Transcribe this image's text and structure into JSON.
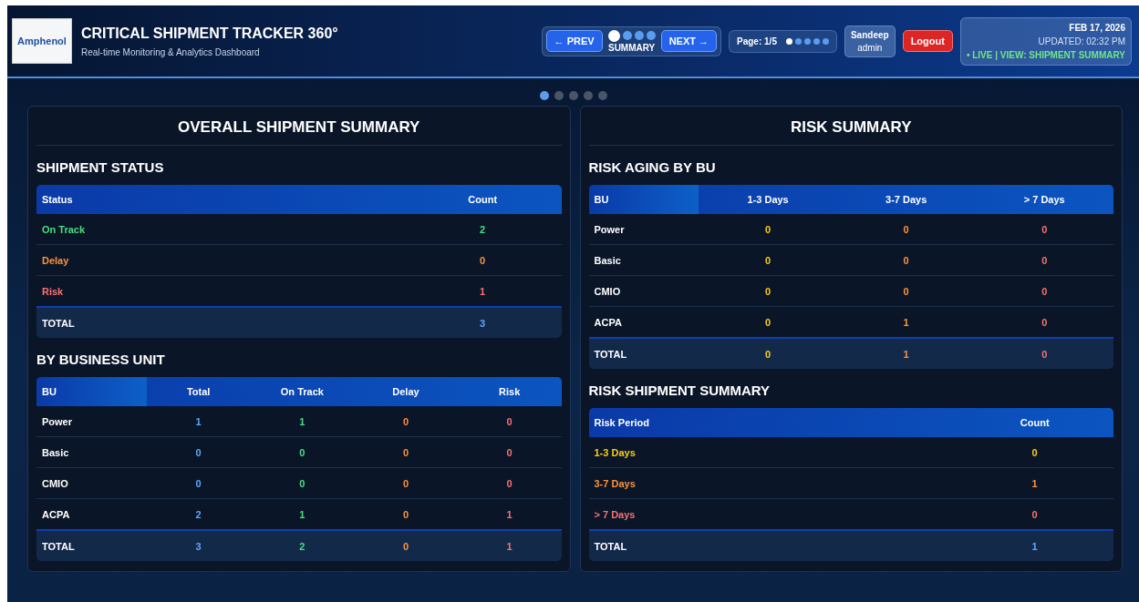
{
  "header": {
    "logo": "Amphenol",
    "title": "CRITICAL SHIPMENT TRACKER 360°",
    "subtitle": "Real-time Monitoring & Analytics Dashboard",
    "nav": {
      "prev": "← PREV",
      "next": "NEXT →",
      "label": "SUMMARY",
      "dots": [
        {
          "selected": true
        },
        {
          "selected": false
        },
        {
          "selected": false
        },
        {
          "selected": false
        }
      ]
    },
    "pager": {
      "label": "Page: 1/5",
      "dots": [
        {
          "selected": true
        },
        {
          "selected": false
        },
        {
          "selected": false
        },
        {
          "selected": false
        },
        {
          "selected": false
        }
      ]
    },
    "user": {
      "name": "Sandeep",
      "role": "admin"
    },
    "logout": "Logout",
    "status": {
      "date": "FEB 17, 2026",
      "updated": "UPDATED: 02:32 PM",
      "live": "• LIVE | VIEW: SHIPMENT SUMMARY"
    }
  },
  "carousel_dots": [
    {
      "selected": true
    },
    {
      "selected": false
    },
    {
      "selected": false
    },
    {
      "selected": false
    },
    {
      "selected": false
    }
  ],
  "panels": [
    {
      "title": "OVERALL SHIPMENT SUMMARY",
      "sections": [
        {
          "title": "SHIPMENT STATUS",
          "table": {
            "columns": [
              "Status",
              "Count"
            ],
            "rows": [
              {
                "kind": "normal",
                "cells": [
                  {
                    "text": "On Track",
                    "color": "#4ade80"
                  },
                  {
                    "text": "2",
                    "color": "#4ade80"
                  }
                ]
              },
              {
                "kind": "normal",
                "cells": [
                  {
                    "text": "Delay",
                    "color": "#fb923c"
                  },
                  {
                    "text": "0",
                    "color": "#fb923c"
                  }
                ]
              },
              {
                "kind": "normal",
                "cells": [
                  {
                    "text": "Risk",
                    "color": "#f87171"
                  },
                  {
                    "text": "1",
                    "color": "#f87171"
                  }
                ]
              },
              {
                "kind": "total",
                "cells": [
                  {
                    "text": "TOTAL",
                    "color": "#ffffff"
                  },
                  {
                    "text": "3",
                    "color": "#60a5fa"
                  }
                ]
              }
            ]
          }
        },
        {
          "title": "BY BUSINESS UNIT",
          "table": {
            "columns": [
              "BU",
              "Total",
              "On Track",
              "Delay",
              "Risk"
            ],
            "rows": [
              {
                "kind": "normal",
                "cells": [
                  {
                    "text": "Power",
                    "color": "#ffffff"
                  },
                  {
                    "text": "1",
                    "color": "#60a5fa"
                  },
                  {
                    "text": "1",
                    "color": "#4ade80"
                  },
                  {
                    "text": "0",
                    "color": "#fb923c"
                  },
                  {
                    "text": "0",
                    "color": "#f87171"
                  }
                ]
              },
              {
                "kind": "normal",
                "cells": [
                  {
                    "text": "Basic",
                    "color": "#ffffff"
                  },
                  {
                    "text": "0",
                    "color": "#60a5fa"
                  },
                  {
                    "text": "0",
                    "color": "#4ade80"
                  },
                  {
                    "text": "0",
                    "color": "#fb923c"
                  },
                  {
                    "text": "0",
                    "color": "#f87171"
                  }
                ]
              },
              {
                "kind": "normal",
                "cells": [
                  {
                    "text": "CMIO",
                    "color": "#ffffff"
                  },
                  {
                    "text": "0",
                    "color": "#60a5fa"
                  },
                  {
                    "text": "0",
                    "color": "#4ade80"
                  },
                  {
                    "text": "0",
                    "color": "#fb923c"
                  },
                  {
                    "text": "0",
                    "color": "#f87171"
                  }
                ]
              },
              {
                "kind": "normal",
                "cells": [
                  {
                    "text": "ACPA",
                    "color": "#ffffff"
                  },
                  {
                    "text": "2",
                    "color": "#60a5fa"
                  },
                  {
                    "text": "1",
                    "color": "#4ade80"
                  },
                  {
                    "text": "0",
                    "color": "#fb923c"
                  },
                  {
                    "text": "1",
                    "color": "#f87171"
                  }
                ]
              },
              {
                "kind": "total",
                "cells": [
                  {
                    "text": "TOTAL",
                    "color": "#ffffff"
                  },
                  {
                    "text": "3",
                    "color": "#60a5fa"
                  },
                  {
                    "text": "2",
                    "color": "#4ade80"
                  },
                  {
                    "text": "0",
                    "color": "#fb923c"
                  },
                  {
                    "text": "1",
                    "color": "#f87171"
                  }
                ]
              }
            ]
          }
        }
      ]
    },
    {
      "title": "RISK SUMMARY",
      "sections": [
        {
          "title": "RISK AGING BY BU",
          "table": {
            "columns": [
              "BU",
              "1-3 Days",
              "3-7 Days",
              "> 7 Days"
            ],
            "rows": [
              {
                "kind": "normal",
                "cells": [
                  {
                    "text": "Power",
                    "color": "#ffffff"
                  },
                  {
                    "text": "0",
                    "color": "#facc15"
                  },
                  {
                    "text": "0",
                    "color": "#fb923c"
                  },
                  {
                    "text": "0",
                    "color": "#f87171"
                  }
                ]
              },
              {
                "kind": "normal",
                "cells": [
                  {
                    "text": "Basic",
                    "color": "#ffffff"
                  },
                  {
                    "text": "0",
                    "color": "#facc15"
                  },
                  {
                    "text": "0",
                    "color": "#fb923c"
                  },
                  {
                    "text": "0",
                    "color": "#f87171"
                  }
                ]
              },
              {
                "kind": "normal",
                "cells": [
                  {
                    "text": "CMIO",
                    "color": "#ffffff"
                  },
                  {
                    "text": "0",
                    "color": "#facc15"
                  },
                  {
                    "text": "0",
                    "color": "#fb923c"
                  },
                  {
                    "text": "0",
                    "color": "#f87171"
                  }
                ]
              },
              {
                "kind": "normal",
                "cells": [
                  {
                    "text": "ACPA",
                    "color": "#ffffff"
                  },
                  {
                    "text": "0",
                    "color": "#facc15"
                  },
                  {
                    "text": "1",
                    "color": "#fb923c"
                  },
                  {
                    "text": "0",
                    "color": "#f87171"
                  }
                ]
              },
              {
                "kind": "total",
                "cells": [
                  {
                    "text": "TOTAL",
                    "color": "#ffffff"
                  },
                  {
                    "text": "0",
                    "color": "#facc15"
                  },
                  {
                    "text": "1",
                    "color": "#fb923c"
                  },
                  {
                    "text": "0",
                    "color": "#f87171"
                  }
                ]
              }
            ]
          }
        },
        {
          "title": "RISK SHIPMENT SUMMARY",
          "table": {
            "columns": [
              "Risk Period",
              "Count"
            ],
            "rows": [
              {
                "kind": "normal",
                "cells": [
                  {
                    "text": "1-3 Days",
                    "color": "#facc15"
                  },
                  {
                    "text": "0",
                    "color": "#facc15"
                  }
                ]
              },
              {
                "kind": "normal",
                "cells": [
                  {
                    "text": "3-7 Days",
                    "color": "#fb923c"
                  },
                  {
                    "text": "1",
                    "color": "#fb923c"
                  }
                ]
              },
              {
                "kind": "normal",
                "cells": [
                  {
                    "text": "> 7 Days",
                    "color": "#f87171"
                  },
                  {
                    "text": "0",
                    "color": "#f87171"
                  }
                ]
              },
              {
                "kind": "total",
                "cells": [
                  {
                    "text": "TOTAL",
                    "color": "#ffffff"
                  },
                  {
                    "text": "1",
                    "color": "#60a5fa"
                  }
                ]
              }
            ]
          }
        }
      ]
    }
  ]
}
